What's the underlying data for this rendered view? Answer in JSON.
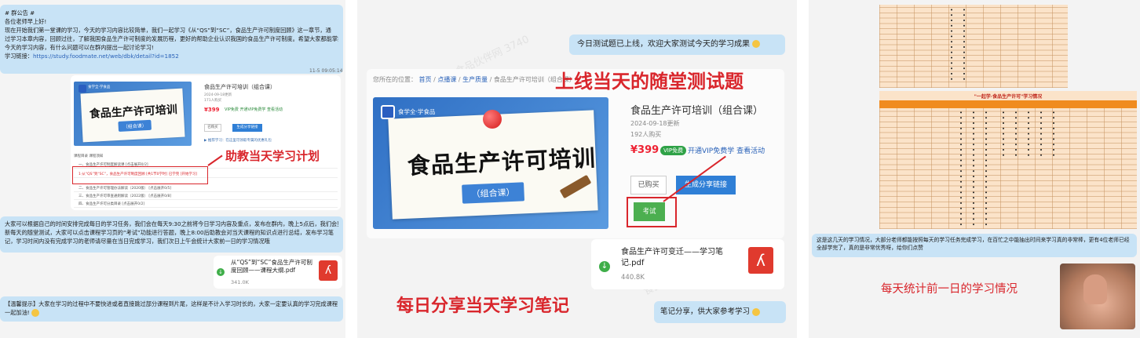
{
  "panel1": {
    "notice_lines": [
      "# 群公告 #",
      "各位老师早上好!",
      "现在开始我们第一堂课的学习，今天的学习内容比较简单，我们一起学习《从“QS”到“SC”，食品生产许可制度回顾》这一章节，通",
      "过学习本章内容，回顾过往，了解我国食品生产许可制度的发展历程，更好的帮助企业认识我国的食品生产许可制度。希望大家都能掌握",
      "今天的学习内容，有什么问题可以在群内提出一起讨论学习!"
    ],
    "link_label": "学习链接：",
    "link_url": "https://study.foodmate.net/web/dbk/detail?id=1852",
    "timestamp": "11-5 09:05:14",
    "shot": {
      "cover_title": "食品生产许可培训",
      "cover_sub": "（组合课）",
      "logo_text": "食学全·学食品",
      "course_title": "食品生产许可培训（组合课）",
      "meta1": "2024-09-18更新",
      "meta2": "171人购买",
      "price": "¥399",
      "vip": "VIP免费 开通VIP免费学 查看活动",
      "btn_bought": "已购买",
      "btn_share": "生成分享链接",
      "share_text": "▶ 推荐学习：在这里可领取专属的优惠礼包",
      "tabs": "课程目录    课程须知",
      "rows": [
        "一、食品生产许可制度解读课 [点击展开0/2]",
        "1·从“QS”到“SC”，食品生产许可制度回顾 [共1节0学时]  已学完  [开始学习]",
        "二、食品生产许可管理办法解读（2020版） [点击展开0/5]",
        "三、食品生产许可审查通则解读（2022版） [点击展开0/8]",
        "四、食品生产许可分类目录 [点击展开0/2]"
      ]
    },
    "annotation": "助教当天学习计划",
    "msg2_lines": [
      "大家可以根据自己的时间安排完成每日的学习任务，我们会在每天9:30之前将今日学习内容及重点，发布在群内，晚上5点后，我们会更",
      "新每天的随堂测试，大家可以点击课程学习页的“考试”功能进行答题，晚上8:00后助教会对当天课程的知识点进行总结，发布学习笔",
      "记，学习时间内没有完成学习的老师请尽量在当日完成学习，我们次日上午会统计大家前一日的学习情况哦"
    ],
    "file_name": "从“QS”到“SC”食品生产许可制度回顾——课程大纲.pdf",
    "file_size": "341.0K",
    "tip_lines": [
      "【温馨提示】大家在学习的过程中不要快进或者直接跳过部分课程到片尾，这样是不计入学习时长的，大家一定要认真的学习完成课程，",
      "一起加油!"
    ]
  },
  "panel2": {
    "bubble1": "今日测试题已上线，欢迎大家测试今天的学习成果",
    "annotation_test": "上线当天的随堂测试题",
    "breadcrumb": [
      "您所在的位置：",
      "首页",
      "点播课",
      "生产质量",
      "食品生产许可培训（组合课）"
    ],
    "cover_title": "食品生产许可培训",
    "cover_sub": "（组合课）",
    "logo_text": "食学全·学食品",
    "course_title": "食品生产许可培训（组合课）",
    "meta1": "2024-09-18更新",
    "meta2": "192人购买",
    "price": "¥399",
    "vip_badge": "VIP免费",
    "vip_link": "开通VIP免费学  查看活动",
    "btn_bought": "已购买",
    "btn_share": "生成分享链接",
    "btn_test": "考试",
    "file_name": "食品生产许可变迁——学习笔记.pdf",
    "file_size": "440.8K",
    "annotation_notes": "每日分享当天学习笔记",
    "bubble2": "笔记分享，供大家参考学习"
  },
  "panel3": {
    "sheet2_title": "\"一起学·食品生产许可\"学习情况",
    "summary_lines": [
      "这是这几天的学习情况，大部分老师都能按照每天的学习任务完成学习，在百忙之中能抽出时间来学习真的非常棒，更有4位老师已经",
      "全部学完了，真的是非常优秀呀，给你们点赞"
    ],
    "annotation": "每天统计前一日的学习情况"
  },
  "colors": {
    "annotation_red": "#d9262c",
    "bubble_blue": "#c8e3f6",
    "accent_blue": "#2f7fd6",
    "pdf_red": "#e03a2e"
  }
}
